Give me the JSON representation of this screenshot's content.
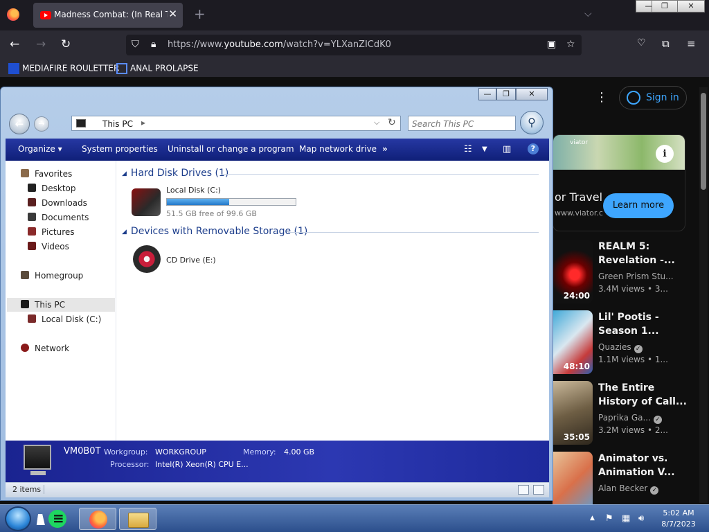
{
  "browser": {
    "tab_title": "Madness Combat: (In Real Time...",
    "tab_close": "✕",
    "new_tab": "+",
    "url_prefix": "https://www.",
    "url_host": "youtube.com",
    "url_path": "/watch?v=YLXanZICdK0",
    "window_controls": [
      "—",
      "❐",
      "✕"
    ],
    "bookmarks": [
      {
        "label": "MEDIAFIRE ROULETTER",
        "icon": "mediafire-icon"
      },
      {
        "label": "ANAL PROLAPSE",
        "icon": "bookmark-icon"
      }
    ]
  },
  "youtube": {
    "sign_in": "Sign in",
    "ad": {
      "logo": "viator",
      "title": "or Travel",
      "url": "www.viator.c",
      "cta": "Learn more",
      "info": "i"
    },
    "videos": [
      {
        "title": "REALM 5: Revelation -...",
        "channel": "Green Prism Stu...",
        "views": "3.4M views  • 3...",
        "duration": "24:00",
        "verified": false
      },
      {
        "title": "Lil' Pootis - Season 1...",
        "channel": "Quazies",
        "views": "1.1M views  • 1...",
        "duration": "48:10",
        "verified": true
      },
      {
        "title": "The Entire History of Call...",
        "channel": "Paprika Ga...",
        "views": "3.2M views  • 2...",
        "duration": "35:05",
        "verified": true
      },
      {
        "title": "Animator vs. Animation V...",
        "channel": "Alan Becker",
        "views": "",
        "duration": "",
        "verified": true
      }
    ]
  },
  "explorer": {
    "window_controls": [
      "—",
      "❐",
      "✕"
    ],
    "address": "This PC",
    "search_placeholder": "Search This PC",
    "toolbar": {
      "organize": "Organize ▾",
      "system_properties": "System properties",
      "uninstall": "Uninstall or change a program",
      "map_drive": "Map network drive",
      "more": "»",
      "help": "?"
    },
    "nav": {
      "favorites": "Favorites",
      "desktop": "Desktop",
      "downloads": "Downloads",
      "documents": "Documents",
      "pictures": "Pictures",
      "videos": "Videos",
      "homegroup": "Homegroup",
      "this_pc": "This PC",
      "local_disk": "Local Disk (C:)",
      "network": "Network"
    },
    "groups": {
      "hard_disks": "Hard Disk Drives (1)",
      "removable": "Devices with Removable Storage (1)"
    },
    "drives": {
      "c_name": "Local Disk (C:)",
      "c_free": "51.5 GB free of 99.6 GB",
      "c_used_fraction": 0.483,
      "cd_name": "CD Drive (E:)"
    },
    "details": {
      "computer_name": "VM0B0T",
      "workgroup_label": "Workgroup:",
      "workgroup": "WORKGROUP",
      "memory_label": "Memory:",
      "memory": "4.00 GB",
      "processor_label": "Processor:",
      "processor": "Intel(R) Xeon(R) CPU E..."
    },
    "status": "2 items"
  },
  "taskbar": {
    "time": "5:02 AM",
    "date": "8/7/2023"
  }
}
